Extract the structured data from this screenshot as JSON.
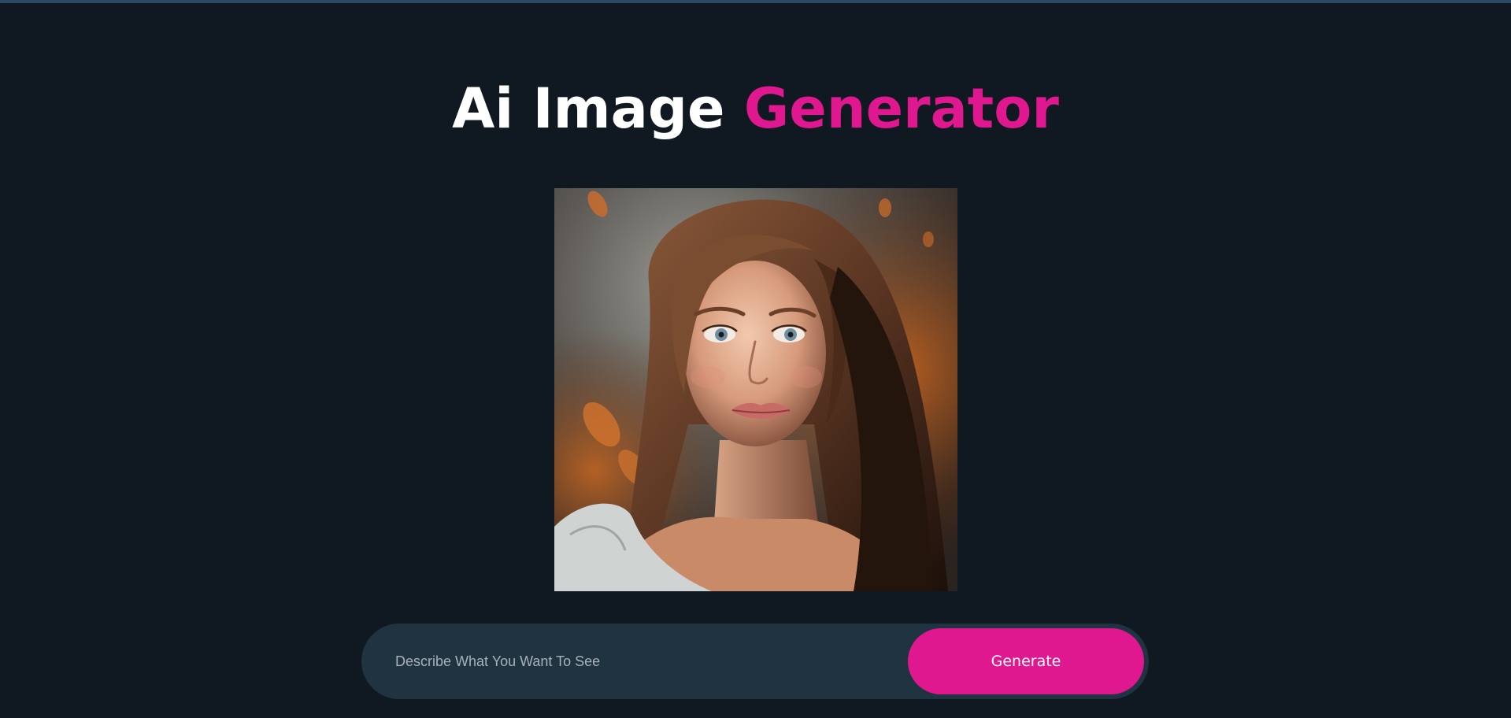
{
  "header": {
    "title_main": "Ai Image ",
    "title_accent": "Generator"
  },
  "image": {
    "subject": "portrait-generated-image"
  },
  "prompt": {
    "placeholder": "Describe What You Want To See",
    "value": ""
  },
  "actions": {
    "generate_label": "Generate"
  },
  "colors": {
    "background": "#101921",
    "accent": "#e0188f",
    "input_bar": "#1f3340"
  }
}
